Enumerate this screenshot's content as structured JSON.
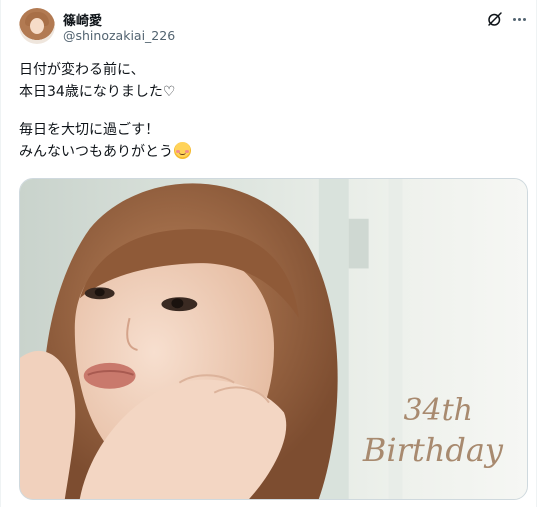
{
  "author": {
    "display_name": "篠崎愛",
    "handle": "@shinozakiai_226"
  },
  "header_icons": {
    "grok": "grok-icon",
    "more": "more-icon"
  },
  "tweet": {
    "line1": "日付が変わる前に、",
    "line2": "本日34歳になりました♡",
    "line3": "毎日を大切に過ごす！",
    "line4": "みんないつもありがとう"
  },
  "media": {
    "overlay_line1": "34th",
    "overlay_line2": "Birthday",
    "description_icon": "portrait-photo"
  },
  "colors": {
    "text": "#0f1419",
    "secondary": "#536471",
    "overlay_text": "#a88a6f",
    "border": "#cfd9de"
  }
}
